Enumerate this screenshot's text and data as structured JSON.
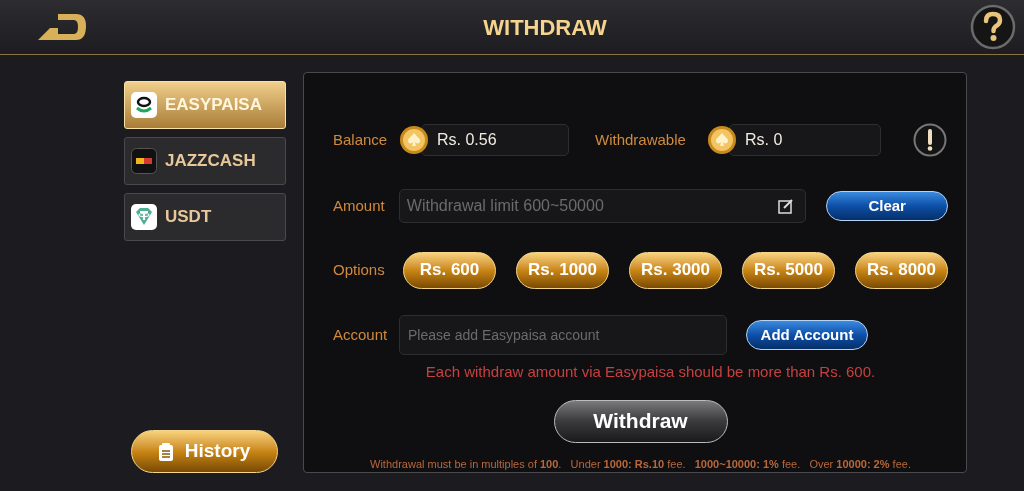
{
  "header": {
    "title": "WITHDRAW"
  },
  "methods": [
    {
      "label": "EASYPAISA",
      "kind": "easypaisa",
      "selected": true
    },
    {
      "label": "JAZZCASH",
      "kind": "jazzcash",
      "selected": false
    },
    {
      "label": "USDT",
      "kind": "usdt",
      "selected": false
    }
  ],
  "history_button": "History",
  "balance": {
    "label": "Balance",
    "value": "Rs. 0.56"
  },
  "withdrawable": {
    "label": "Withdrawable",
    "value": "Rs. 0"
  },
  "amount": {
    "label": "Amount",
    "placeholder": "Withdrawal limit 600~50000",
    "clear_button": "Clear"
  },
  "options": {
    "label": "Options",
    "items": [
      "Rs. 600",
      "Rs. 1000",
      "Rs. 3000",
      "Rs. 5000",
      "Rs. 8000"
    ]
  },
  "account": {
    "label": "Account",
    "placeholder": "Please add Easypaisa account",
    "add_button": "Add Account"
  },
  "error": "Each withdraw amount via Easypaisa should be more than Rs. 600.",
  "withdraw_button": "Withdraw",
  "footer_note": "Withdrawal must be in multiples of **100**.   Under **1000: Rs.10** fee.   **1000~10000: 1%** fee.   Over **10000: 2%** fee."
}
